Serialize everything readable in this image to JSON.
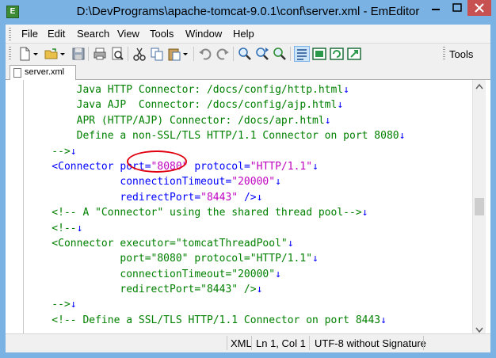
{
  "window": {
    "title": "D:\\DevPrograms\\apache-tomcat-9.0.1\\conf\\server.xml - EmEditor"
  },
  "menu": [
    "File",
    "Edit",
    "Search",
    "View",
    "Tools",
    "Window",
    "Help"
  ],
  "toolbar": {
    "tools_label": "Tools",
    "buttons": [
      "new-file-icon",
      "open-folder-icon",
      "save-icon",
      "print-icon",
      "print-preview-icon",
      "cut-icon",
      "copy-icon",
      "paste-icon",
      "undo-icon",
      "redo-icon",
      "find-icon",
      "find-next-icon",
      "replace-icon",
      "word-wrap-icon",
      "view-icon",
      "refresh-icon",
      "macro-icon"
    ]
  },
  "tab": {
    "label": "server.xml"
  },
  "editor": {
    "lines": [
      {
        "parts": [
          {
            "t": "        Java HTTP Connector: /docs/config/http.html",
            "c": "green"
          },
          {
            "t": "↓",
            "c": "eol"
          }
        ]
      },
      {
        "parts": [
          {
            "t": "        Java AJP  Connector: /docs/config/ajp.html",
            "c": "green"
          },
          {
            "t": "↓",
            "c": "eol"
          }
        ]
      },
      {
        "parts": [
          {
            "t": "        APR (HTTP/AJP) Connector: /docs/apr.html",
            "c": "green"
          },
          {
            "t": "↓",
            "c": "eol"
          }
        ]
      },
      {
        "parts": [
          {
            "t": "        Define a non-SSL/TLS HTTP/1.1 Connector on port 8080",
            "c": "green"
          },
          {
            "t": "↓",
            "c": "eol"
          }
        ]
      },
      {
        "parts": [
          {
            "t": "    -->",
            "c": "green"
          },
          {
            "t": "↓",
            "c": "eol"
          }
        ]
      },
      {
        "parts": [
          {
            "t": "    <Connector port=",
            "c": "blue"
          },
          {
            "t": "\"8080\"",
            "c": "mag"
          },
          {
            "t": " protocol=",
            "c": "blue"
          },
          {
            "t": "\"HTTP/1.1\"",
            "c": "mag"
          },
          {
            "t": "↓",
            "c": "eol"
          }
        ]
      },
      {
        "parts": [
          {
            "t": "               connectionTimeout=",
            "c": "blue"
          },
          {
            "t": "\"20000\"",
            "c": "mag"
          },
          {
            "t": "↓",
            "c": "eol"
          }
        ]
      },
      {
        "parts": [
          {
            "t": "               redirectPort=",
            "c": "blue"
          },
          {
            "t": "\"8443\"",
            "c": "mag"
          },
          {
            "t": " />",
            "c": "blue"
          },
          {
            "t": "↓",
            "c": "eol"
          }
        ]
      },
      {
        "parts": [
          {
            "t": "    <!-- A \"Connector\" using the shared thread pool-->",
            "c": "green"
          },
          {
            "t": "↓",
            "c": "eol"
          }
        ]
      },
      {
        "parts": [
          {
            "t": "    <!--",
            "c": "green"
          },
          {
            "t": "↓",
            "c": "eol"
          }
        ]
      },
      {
        "parts": [
          {
            "t": "    <Connector executor=\"tomcatThreadPool\"",
            "c": "green"
          },
          {
            "t": "↓",
            "c": "eol"
          }
        ]
      },
      {
        "parts": [
          {
            "t": "               port=\"8080\" protocol=\"HTTP/1.1\"",
            "c": "green"
          },
          {
            "t": "↓",
            "c": "eol"
          }
        ]
      },
      {
        "parts": [
          {
            "t": "               connectionTimeout=\"20000\"",
            "c": "green"
          },
          {
            "t": "↓",
            "c": "eol"
          }
        ]
      },
      {
        "parts": [
          {
            "t": "               redirectPort=\"8443\" />",
            "c": "green"
          },
          {
            "t": "↓",
            "c": "eol"
          }
        ]
      },
      {
        "parts": [
          {
            "t": "    -->",
            "c": "green"
          },
          {
            "t": "↓",
            "c": "eol"
          }
        ]
      },
      {
        "parts": [
          {
            "t": "    <!-- Define a SSL/TLS HTTP/1.1 Connector on port 8443",
            "c": "green"
          },
          {
            "t": "↓",
            "c": "eol"
          }
        ]
      }
    ]
  },
  "status": {
    "mode": "XML",
    "position": "Ln 1, Col 1",
    "encoding": "UTF-8 without Signature"
  },
  "colors": {
    "comment": "#008000",
    "tag": "#0000ff",
    "value": "#c000c0",
    "highlight_circle": "#e00010",
    "title_bar": "#7ab2e4"
  }
}
